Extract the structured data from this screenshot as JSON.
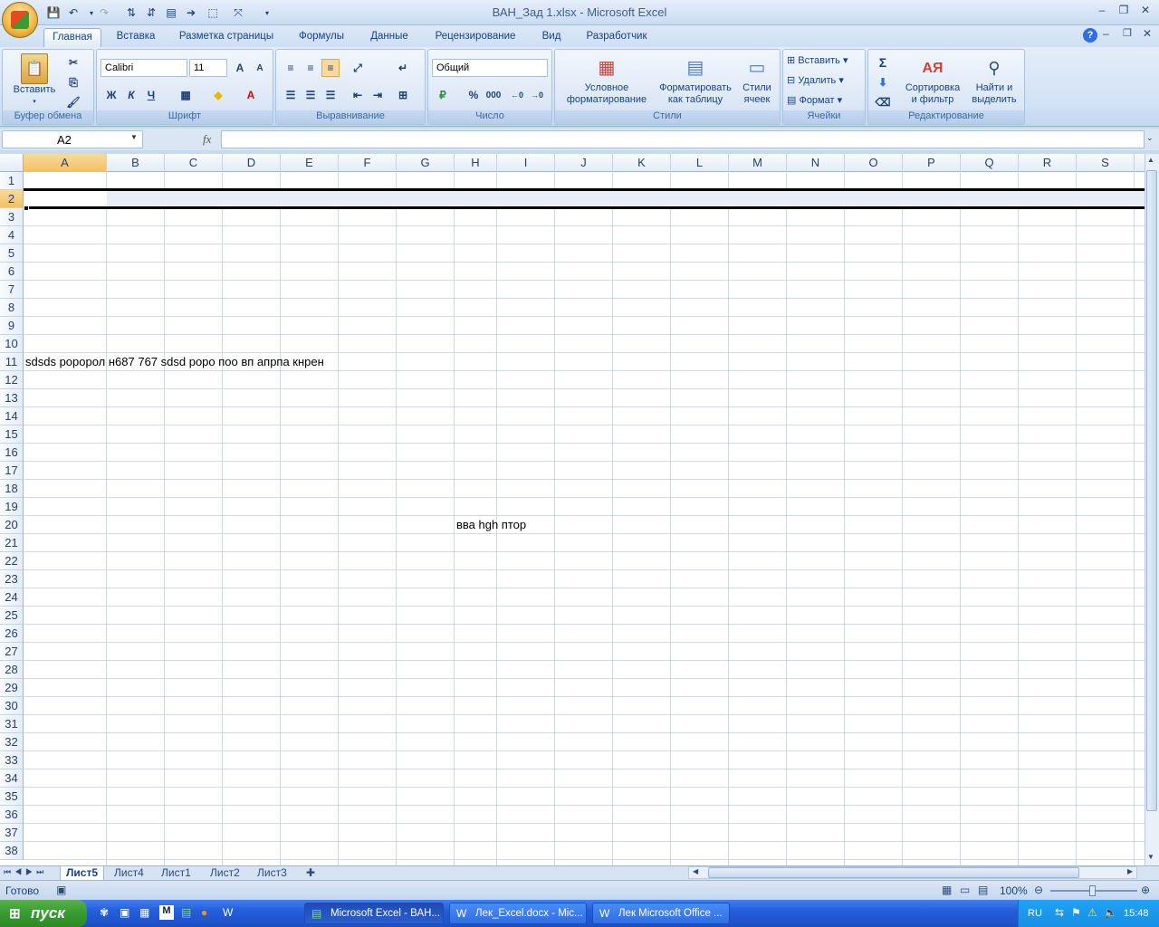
{
  "window": {
    "title": "ВАН_Зад 1.xlsx - Microsoft Excel",
    "minimize": "‒",
    "maximize": "❐",
    "close": "✕"
  },
  "ribbon_tabs": [
    "Главная",
    "Вставка",
    "Разметка страницы",
    "Формулы",
    "Данные",
    "Рецензирование",
    "Вид",
    "Разработчик"
  ],
  "groups": {
    "clipboard": {
      "label": "Буфер обмена",
      "paste": "Вставить"
    },
    "font": {
      "label": "Шрифт",
      "font_name": "Calibri",
      "font_size": "11",
      "bold": "Ж",
      "italic": "К",
      "underline": "Ч"
    },
    "alignment": {
      "label": "Выравнивание"
    },
    "number": {
      "label": "Число",
      "format": "Общий",
      "percent": "%",
      "thousands": "000"
    },
    "styles": {
      "label": "Стили",
      "conditional": "Условное\nформатирование",
      "as_table": "Форматировать\nкак таблицу",
      "cell_styles": "Стили\nячеек"
    },
    "cells": {
      "label": "Ячейки",
      "insert": "Вставить",
      "delete": "Удалить",
      "format": "Формат"
    },
    "editing": {
      "label": "Редактирование",
      "sort": "Сортировка\nи фильтр",
      "find": "Найти и\nвыделить"
    }
  },
  "formula_bar": {
    "name_box": "A2",
    "fx": "fx",
    "value": ""
  },
  "columns": [
    "A",
    "B",
    "C",
    "D",
    "E",
    "F",
    "G",
    "H",
    "I",
    "J",
    "K",
    "L",
    "M",
    "N",
    "O",
    "P",
    "Q",
    "R",
    "S"
  ],
  "rows": [
    "1",
    "2",
    "3",
    "4",
    "5",
    "6",
    "7",
    "8",
    "9",
    "10",
    "11",
    "12",
    "13",
    "14",
    "15",
    "16",
    "17",
    "18",
    "19",
    "20",
    "21",
    "22",
    "23",
    "24",
    "25",
    "26",
    "27",
    "28",
    "29",
    "30",
    "31",
    "32",
    "33",
    "34",
    "35",
    "36",
    "37",
    "38"
  ],
  "cells": {
    "A11": "sdsds роророл н687 767  sdsd роро поо вп апрпа кнрен",
    "H20": "вва hgh птор"
  },
  "sheet_tabs": [
    "Лист5",
    "Лист4",
    "Лист1",
    "Лист2",
    "Лист3"
  ],
  "status": {
    "ready": "Готово",
    "zoom": "100%"
  },
  "taskbar": {
    "start": "пуск",
    "tasks": [
      "Microsoft Excel - ВАН...",
      "Лек_Excel.docx - Mic...",
      "Лек Microsoft Office ..."
    ],
    "lang": "RU",
    "time": "15:48"
  }
}
